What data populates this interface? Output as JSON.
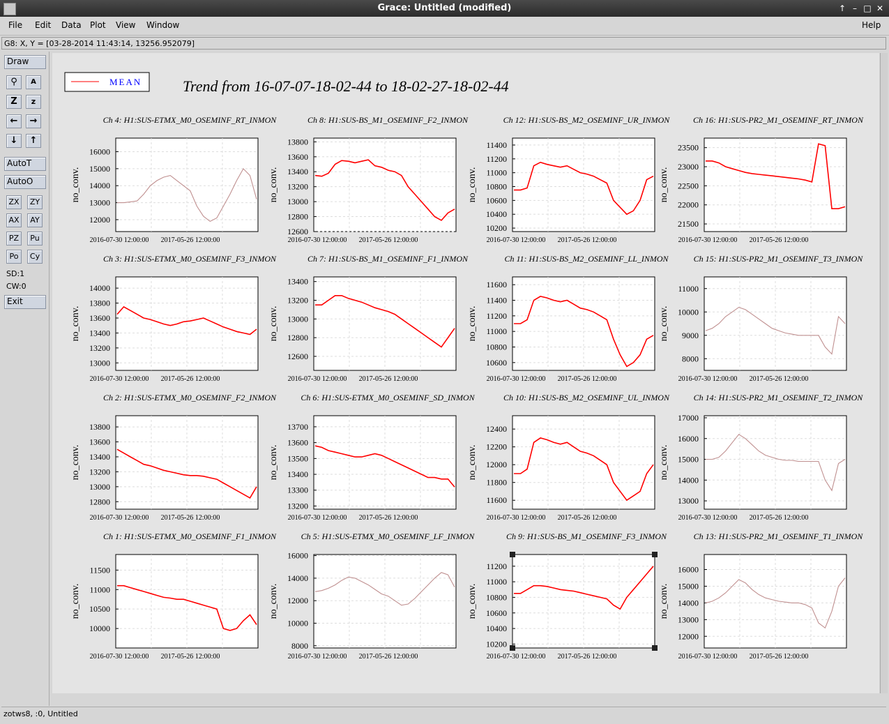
{
  "window": {
    "title": "Grace: Untitled (modified)"
  },
  "menubar": {
    "items": [
      {
        "label": "File"
      },
      {
        "label": "Edit"
      },
      {
        "label": "Data"
      },
      {
        "label": "Plot"
      },
      {
        "label": "View"
      },
      {
        "label": "Window"
      }
    ],
    "help": "Help"
  },
  "locator": {
    "text": "G8: X, Y = [03-28-2014 11:43:14, 13256.952079]"
  },
  "toolbar": {
    "draw": "Draw",
    "autot": "AutoT",
    "autoo": "AutoO",
    "zx": "ZX",
    "zy": "ZY",
    "ax": "AX",
    "ay": "AY",
    "pz": "PZ",
    "pu": "Pu",
    "po": "Po",
    "cy": "Cy",
    "sd": "SD:1",
    "cw": "CW:0",
    "exit": "Exit",
    "icons": [
      "magnify-icon",
      "autoscale-text-icon",
      "zoom-z-icon",
      "zoom-small-z-icon",
      "arrow-left-icon",
      "arrow-right-icon",
      "arrow-down-icon",
      "arrow-up-icon"
    ]
  },
  "status": {
    "text": "zotws8, :0, Untitled"
  },
  "legend": {
    "label": "MEAN",
    "line_color": "#ff0000",
    "text_color": "#0000ff"
  },
  "page_title": "Trend from 16-07-07-18-02-44 to 18-02-27-18-02-44",
  "xticks": [
    "2016-07-30 12:00:00",
    "2017-05-26 12:00:00"
  ],
  "ylabel": "no_conv.",
  "chart_data": [
    {
      "type": "line",
      "title": "Ch 4: H1:SUS-ETMX_M0_OSEMINF_RT_INMON",
      "yticks": [
        16000,
        15000,
        14000,
        13000,
        12000
      ],
      "ylim": [
        11300,
        16800
      ],
      "color": "#c09090",
      "series": [
        {
          "values": [
            13000,
            13000,
            13050,
            13100,
            13500,
            14000,
            14300,
            14500,
            14600,
            14300,
            14000,
            13700,
            12800,
            12200,
            11900,
            12100,
            12800,
            13500,
            14300,
            15000,
            14600,
            13200
          ]
        }
      ]
    },
    {
      "type": "line",
      "title": "Ch 8: H1:SUS-BS_M1_OSEMINF_F2_INMON",
      "yticks": [
        13800,
        13600,
        13400,
        13200,
        13000,
        12800,
        12600
      ],
      "ylim": [
        12600,
        13850
      ],
      "color": "#ff0000",
      "series": [
        {
          "values": [
            13350,
            13340,
            13380,
            13500,
            13550,
            13540,
            13520,
            13540,
            13560,
            13480,
            13460,
            13420,
            13400,
            13350,
            13200,
            13100,
            13000,
            12900,
            12800,
            12750,
            12850,
            12900
          ]
        }
      ]
    },
    {
      "type": "line",
      "title": "Ch 12: H1:SUS-BS_M2_OSEMINF_UR_INMON",
      "yticks": [
        11400,
        11200,
        11000,
        10800,
        10600,
        10400,
        10200
      ],
      "ylim": [
        10150,
        11500
      ],
      "color": "#ff0000",
      "series": [
        {
          "values": [
            10750,
            10750,
            10780,
            11100,
            11150,
            11120,
            11100,
            11080,
            11100,
            11050,
            11000,
            10980,
            10950,
            10900,
            10850,
            10600,
            10500,
            10400,
            10450,
            10600,
            10900,
            10950
          ]
        }
      ]
    },
    {
      "type": "line",
      "title": "Ch 16: H1:SUS-PR2_M1_OSEMINF_RT_INMON",
      "yticks": [
        23500,
        23000,
        22500,
        22000,
        21500
      ],
      "ylim": [
        21300,
        23750
      ],
      "color": "#ff0000",
      "series": [
        {
          "values": [
            23150,
            23150,
            23100,
            23000,
            22950,
            22900,
            22850,
            22820,
            22800,
            22780,
            22760,
            22740,
            22720,
            22700,
            22680,
            22650,
            22600,
            23600,
            23550,
            21900,
            21900,
            21950
          ]
        }
      ]
    },
    {
      "type": "line",
      "title": "Ch 3: H1:SUS-ETMX_M0_OSEMINF_F3_INMON",
      "yticks": [
        14000,
        13800,
        13600,
        13400,
        13200,
        13000
      ],
      "ylim": [
        12900,
        14150
      ],
      "color": "#ff0000",
      "series": [
        {
          "values": [
            13650,
            13750,
            13700,
            13650,
            13600,
            13580,
            13550,
            13520,
            13500,
            13520,
            13550,
            13560,
            13580,
            13600,
            13560,
            13520,
            13480,
            13450,
            13420,
            13400,
            13380,
            13450
          ]
        }
      ]
    },
    {
      "type": "line",
      "title": "Ch 7: H1:SUS-BS_M1_OSEMINF_F1_INMON",
      "yticks": [
        13400,
        13200,
        13000,
        12800,
        12600
      ],
      "ylim": [
        12450,
        13450
      ],
      "color": "#ff0000",
      "series": [
        {
          "values": [
            13150,
            13150,
            13200,
            13250,
            13250,
            13220,
            13200,
            13180,
            13150,
            13120,
            13100,
            13080,
            13050,
            13000,
            12950,
            12900,
            12850,
            12800,
            12750,
            12700,
            12800,
            12900
          ]
        }
      ]
    },
    {
      "type": "line",
      "title": "Ch 11: H1:SUS-BS_M2_OSEMINF_LL_INMON",
      "yticks": [
        11600,
        11400,
        11200,
        11000,
        10800,
        10600
      ],
      "ylim": [
        10500,
        11700
      ],
      "color": "#ff0000",
      "series": [
        {
          "values": [
            11100,
            11100,
            11150,
            11400,
            11450,
            11430,
            11400,
            11380,
            11400,
            11350,
            11300,
            11280,
            11250,
            11200,
            11150,
            10900,
            10700,
            10550,
            10600,
            10700,
            10900,
            10950
          ]
        }
      ]
    },
    {
      "type": "line",
      "title": "Ch 15: H1:SUS-PR2_M1_OSEMINF_T3_INMON",
      "yticks": [
        11000,
        10000,
        9000,
        8000
      ],
      "ylim": [
        7500,
        11500
      ],
      "color": "#c09090",
      "series": [
        {
          "values": [
            9200,
            9300,
            9500,
            9800,
            10000,
            10200,
            10100,
            9900,
            9700,
            9500,
            9300,
            9200,
            9100,
            9050,
            9000,
            9000,
            9000,
            9000,
            8500,
            8200,
            9800,
            9500
          ]
        }
      ]
    },
    {
      "type": "line",
      "title": "Ch 2: H1:SUS-ETMX_M0_OSEMINF_F2_INMON",
      "yticks": [
        13800,
        13600,
        13400,
        13200,
        13000,
        12800
      ],
      "ylim": [
        12700,
        13950
      ],
      "color": "#ff0000",
      "series": [
        {
          "values": [
            13500,
            13450,
            13400,
            13350,
            13300,
            13280,
            13250,
            13220,
            13200,
            13180,
            13160,
            13150,
            13150,
            13140,
            13120,
            13100,
            13050,
            13000,
            12950,
            12900,
            12850,
            13000
          ]
        }
      ]
    },
    {
      "type": "line",
      "title": "Ch 6: H1:SUS-ETMX_M0_OSEMINF_SD_INMON",
      "yticks": [
        13700,
        13600,
        13500,
        13400,
        13300,
        13200
      ],
      "ylim": [
        13180,
        13770
      ],
      "color": "#ff0000",
      "series": [
        {
          "values": [
            13580,
            13570,
            13550,
            13540,
            13530,
            13520,
            13510,
            13510,
            13520,
            13530,
            13520,
            13500,
            13480,
            13460,
            13440,
            13420,
            13400,
            13380,
            13380,
            13370,
            13370,
            13320
          ]
        }
      ]
    },
    {
      "type": "line",
      "title": "Ch 10: H1:SUS-BS_M2_OSEMINF_UL_INMON",
      "yticks": [
        12400,
        12200,
        12000,
        11800,
        11600
      ],
      "ylim": [
        11500,
        12550
      ],
      "color": "#ff0000",
      "series": [
        {
          "values": [
            11900,
            11900,
            11950,
            12250,
            12300,
            12280,
            12250,
            12230,
            12250,
            12200,
            12150,
            12130,
            12100,
            12050,
            12000,
            11800,
            11700,
            11600,
            11650,
            11700,
            11900,
            12000
          ]
        }
      ]
    },
    {
      "type": "line",
      "title": "Ch 14: H1:SUS-PR2_M1_OSEMINF_T2_INMON",
      "yticks": [
        17000,
        16000,
        15000,
        14000,
        13000
      ],
      "ylim": [
        12600,
        17100
      ],
      "color": "#c09090",
      "series": [
        {
          "values": [
            15000,
            15000,
            15100,
            15400,
            15800,
            16200,
            16000,
            15700,
            15400,
            15200,
            15100,
            15000,
            14950,
            14950,
            14900,
            14900,
            14900,
            14900,
            14000,
            13500,
            14800,
            15000
          ]
        }
      ]
    },
    {
      "type": "line",
      "title": "Ch 1: H1:SUS-ETMX_M0_OSEMINF_F1_INMON",
      "yticks": [
        11500,
        11000,
        10500,
        10000
      ],
      "ylim": [
        9500,
        11900
      ],
      "color": "#ff0000",
      "series": [
        {
          "values": [
            11100,
            11100,
            11050,
            11000,
            10950,
            10900,
            10850,
            10800,
            10780,
            10750,
            10750,
            10700,
            10650,
            10600,
            10550,
            10500,
            10000,
            9950,
            10000,
            10200,
            10350,
            10100
          ]
        }
      ]
    },
    {
      "type": "line",
      "title": "Ch 5: H1:SUS-ETMX_M0_OSEMINF_LF_INMON",
      "yticks": [
        16000,
        14000,
        12000,
        10000,
        8000
      ],
      "ylim": [
        7800,
        16100
      ],
      "color": "#c09090",
      "series": [
        {
          "values": [
            12800,
            12900,
            13100,
            13400,
            13800,
            14100,
            14000,
            13700,
            13400,
            13000,
            12600,
            12400,
            12000,
            11600,
            11700,
            12200,
            12800,
            13400,
            14000,
            14500,
            14300,
            13200
          ]
        }
      ]
    },
    {
      "type": "line",
      "title": "Ch 9: H1:SUS-BS_M1_OSEMINF_F3_INMON",
      "yticks": [
        11200,
        11000,
        10800,
        10600,
        10400,
        10200
      ],
      "ylim": [
        10150,
        11350
      ],
      "color": "#ff0000",
      "series": [
        {
          "values": [
            10850,
            10850,
            10900,
            10950,
            10950,
            10940,
            10920,
            10900,
            10890,
            10880,
            10860,
            10840,
            10820,
            10800,
            10780,
            10700,
            10650,
            10800,
            10900,
            11000,
            11100,
            11200
          ]
        }
      ]
    },
    {
      "type": "line",
      "title": "Ch 13: H1:SUS-PR2_M1_OSEMINF_T1_INMON",
      "yticks": [
        16000,
        15000,
        14000,
        13000,
        12000
      ],
      "ylim": [
        11300,
        16900
      ],
      "color": "#c09090",
      "series": [
        {
          "values": [
            14000,
            14100,
            14300,
            14600,
            15000,
            15400,
            15200,
            14800,
            14500,
            14300,
            14200,
            14100,
            14050,
            14000,
            14000,
            13900,
            13700,
            12800,
            12500,
            13500,
            15000,
            15500
          ]
        }
      ]
    }
  ]
}
